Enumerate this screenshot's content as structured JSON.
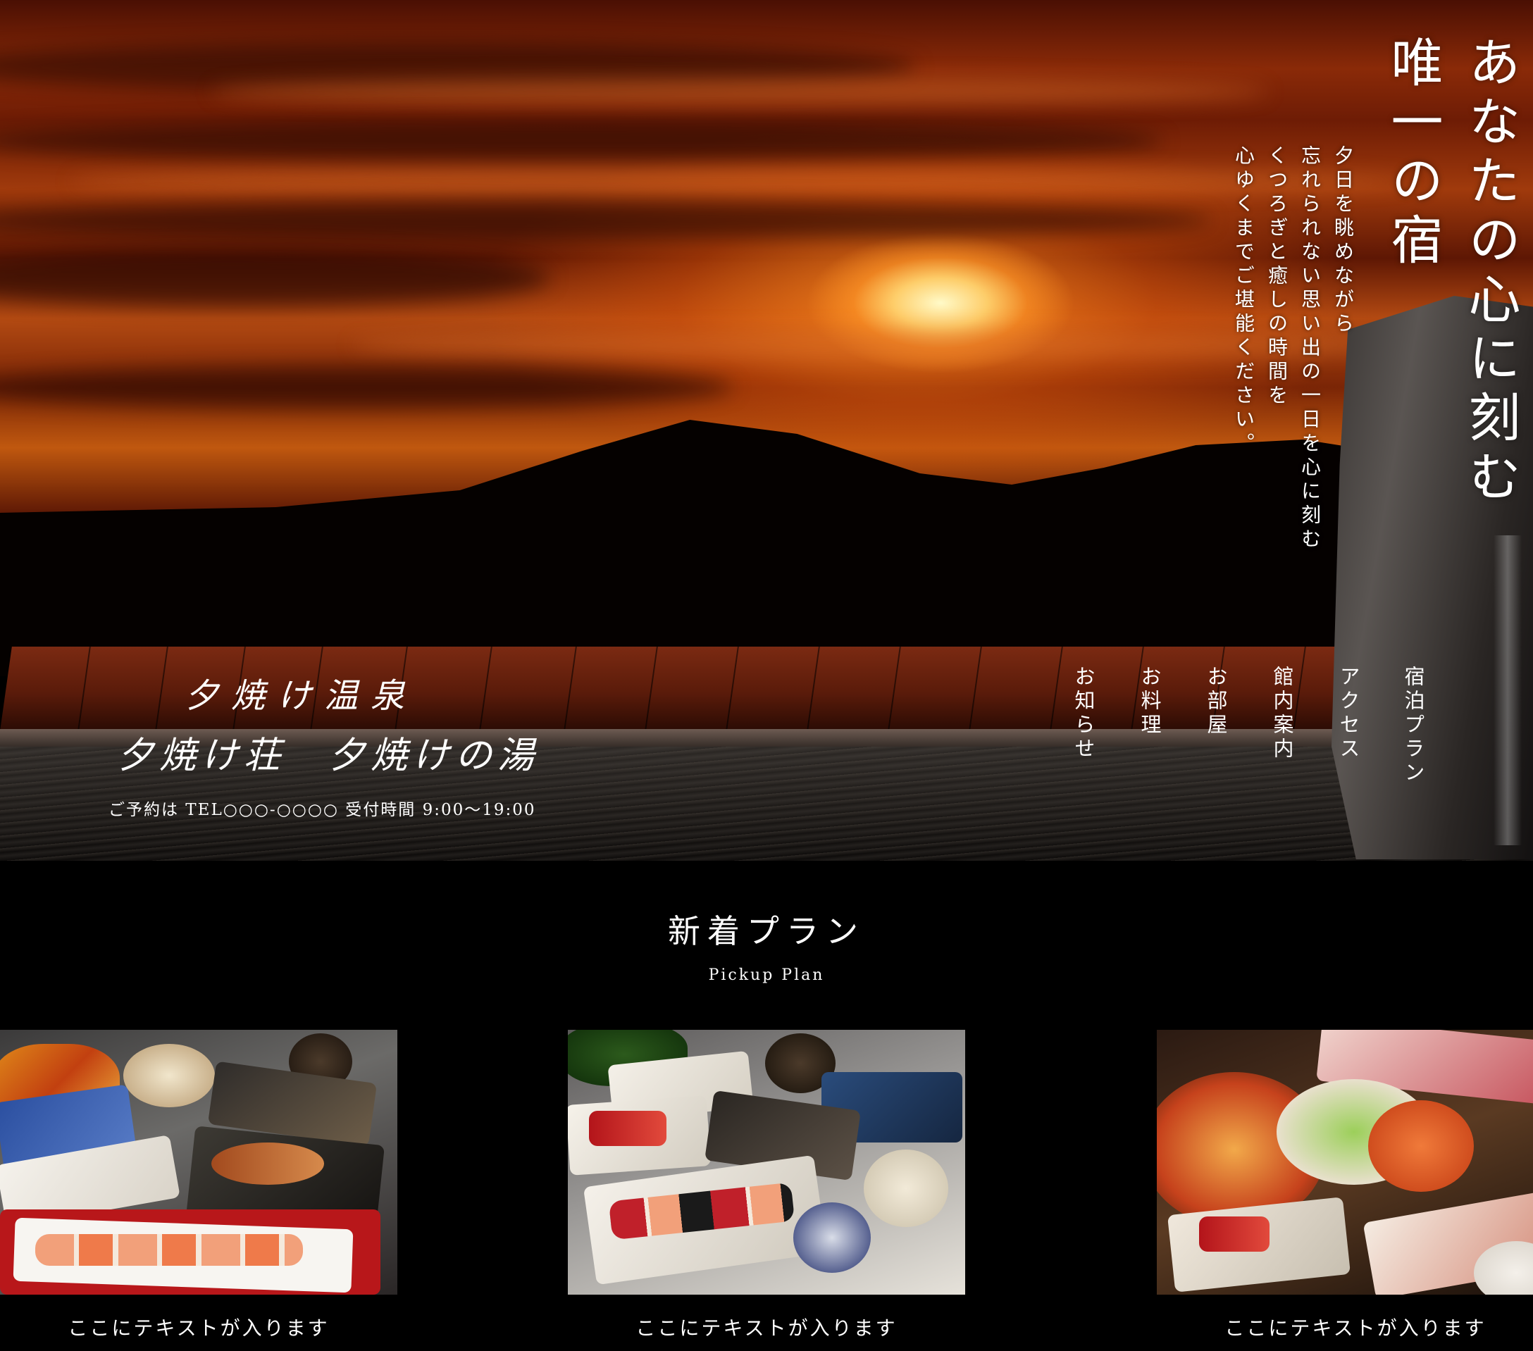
{
  "hero": {
    "headline": "あなたの心に刻む唯一の宿",
    "tagline_lines": [
      "夕日を眺めながら",
      "忘れられない思い出の一日を心に刻む",
      "くつろぎと癒しの時間を",
      "心ゆくまでご堪能ください。"
    ],
    "logo_line1": "夕焼け温泉",
    "logo_line2": "夕焼け荘　夕焼けの湯",
    "reservation": "ご予約は TEL○○○-○○○○ 受付時間 9:00〜19:00"
  },
  "nav": {
    "items": [
      {
        "label": "宿泊プラン"
      },
      {
        "label": "アクセス"
      },
      {
        "label": "館内案内"
      },
      {
        "label": "お部屋"
      },
      {
        "label": "お料理"
      },
      {
        "label": "お知らせ"
      }
    ]
  },
  "pickup": {
    "title": "新着プラン",
    "subtitle": "Pickup Plan",
    "cards": [
      {
        "caption": "ここにテキストが入ります"
      },
      {
        "caption": "ここにテキストが入ります"
      },
      {
        "caption": "ここにテキストが入ります"
      }
    ]
  }
}
